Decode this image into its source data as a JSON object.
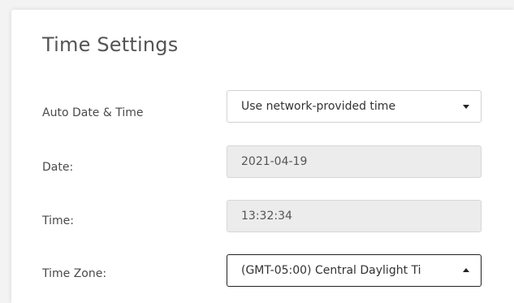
{
  "section": {
    "title": "Time Settings"
  },
  "rows": {
    "auto": {
      "label": "Auto Date & Time",
      "value": "Use network-provided time",
      "icon": "chevron-down-icon"
    },
    "date": {
      "label": "Date:",
      "value": "2021-04-19"
    },
    "time": {
      "label": "Time:",
      "value": "13:32:34"
    },
    "timezone": {
      "label": "Time Zone:",
      "value": "(GMT-05:00) Central Daylight Ti",
      "icon": "chevron-up-icon"
    }
  }
}
